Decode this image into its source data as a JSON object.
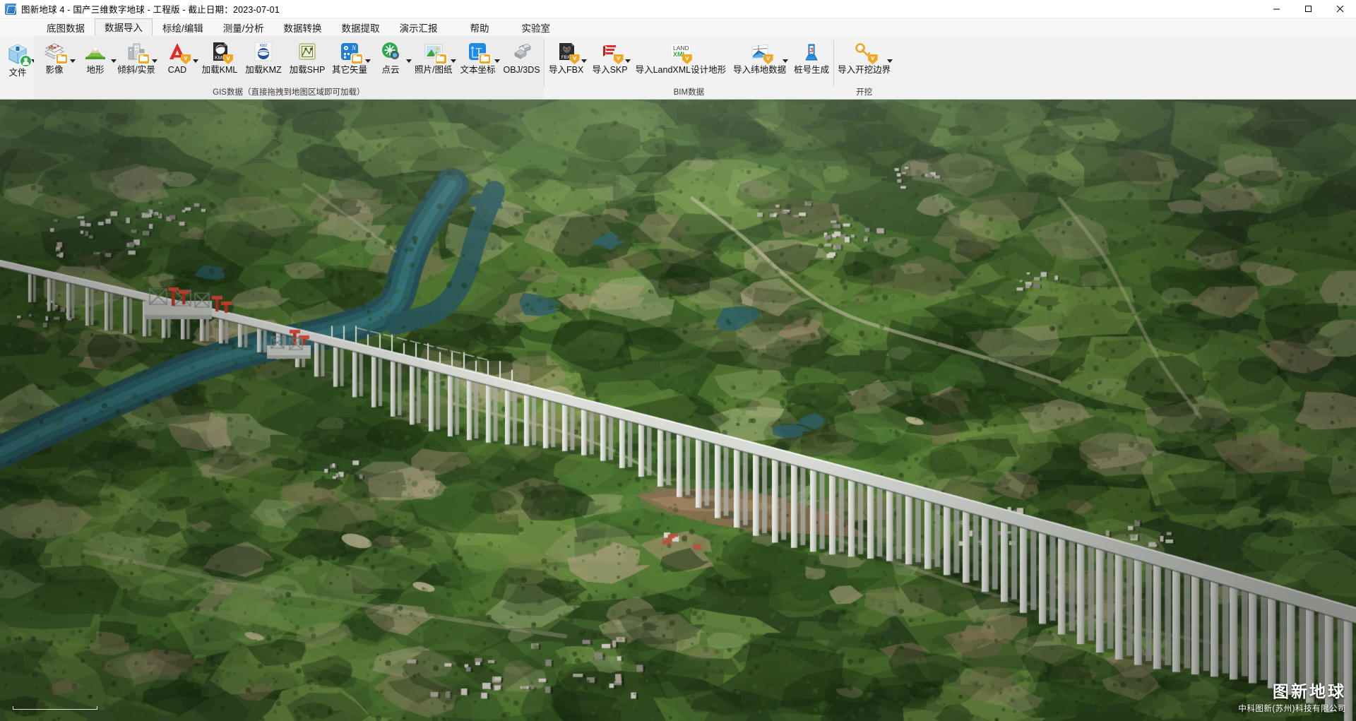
{
  "window": {
    "title": "图新地球 4 - 国产三维数字地球 - 工程版 - 截止日期：2023-07-01",
    "logo_icon": "app-globe-icon",
    "minimize_icon": "minimize-icon",
    "maximize_icon": "maximize-icon",
    "close_icon": "close-icon"
  },
  "menu": {
    "tabs": [
      {
        "label": "底图数据",
        "active": false
      },
      {
        "label": "数据导入",
        "active": true
      },
      {
        "label": "标绘/编辑",
        "active": false
      },
      {
        "label": "测量/分析",
        "active": false
      },
      {
        "label": "数据转换",
        "active": false
      },
      {
        "label": "数据提取",
        "active": false
      },
      {
        "label": "演示汇报",
        "active": false
      },
      {
        "label": "帮助",
        "active": false
      },
      {
        "label": "实验室",
        "active": false
      }
    ]
  },
  "ribbon": {
    "file_button": {
      "label": "文件",
      "icon": "file-box-icon",
      "has_dropdown": true
    },
    "groups": [
      {
        "id": "gis",
        "label": "GIS数据（直接拖拽到地图区域即可加载）",
        "items": [
          {
            "label": "影像",
            "icon": "imagery-layers-icon",
            "has_dropdown": true
          },
          {
            "label": "地形",
            "icon": "terrain-mountain-icon",
            "has_dropdown": true
          },
          {
            "label": "倾斜/实景",
            "icon": "oblique-city-icon",
            "has_dropdown": true
          },
          {
            "label": "CAD",
            "icon": "autocad-icon",
            "has_dropdown": true
          },
          {
            "label": "加载KML",
            "icon": "kml-document-icon",
            "has_dropdown": false
          },
          {
            "label": "加载KMZ",
            "icon": "kmz-globe-icon",
            "has_dropdown": false
          },
          {
            "label": "加载SHP",
            "icon": "shapefile-icon",
            "has_dropdown": false
          },
          {
            "label": "其它矢量",
            "icon": "other-vector-icon",
            "has_dropdown": true
          },
          {
            "label": "点云",
            "icon": "point-cloud-icon",
            "has_dropdown": true
          },
          {
            "label": "照片/图纸",
            "icon": "photo-drawing-icon",
            "has_dropdown": true
          },
          {
            "label": "文本坐标",
            "icon": "text-coordinate-icon",
            "has_dropdown": true
          },
          {
            "label": "OBJ/3DS",
            "icon": "obj-3ds-model-icon",
            "has_dropdown": false
          }
        ]
      },
      {
        "id": "bim",
        "label": "BIM数据",
        "items": [
          {
            "label": "导入FBX",
            "icon": "fbx-icon",
            "has_dropdown": true
          },
          {
            "label": "导入SKP",
            "icon": "sketchup-icon",
            "has_dropdown": true
          },
          {
            "label": "导入LandXML设计地形",
            "icon": "landxml-icon",
            "has_dropdown": false
          },
          {
            "label": "导入纬地数据",
            "icon": "weidi-data-icon",
            "has_dropdown": true
          },
          {
            "label": "桩号生成",
            "icon": "stake-number-icon",
            "has_dropdown": false
          }
        ]
      },
      {
        "id": "excavation",
        "label": "开挖",
        "items": [
          {
            "label": "导入开挖边界",
            "icon": "excavation-boundary-icon",
            "has_dropdown": true
          }
        ]
      }
    ]
  },
  "viewport": {
    "name": "3d-earth-viewport",
    "scene_description": "倾斜摄影实景三维场景 - 高架桥跨越河谷",
    "watermark_main": "图新地球",
    "watermark_sub": "中科图新(苏州)科技有限公司",
    "colors": {
      "vegetation_dark": "#2f4a22",
      "vegetation_light": "#6f9b4a",
      "water": "#2d5f66",
      "bridge": "#cfd1cc",
      "soil": "#9a8064"
    }
  }
}
